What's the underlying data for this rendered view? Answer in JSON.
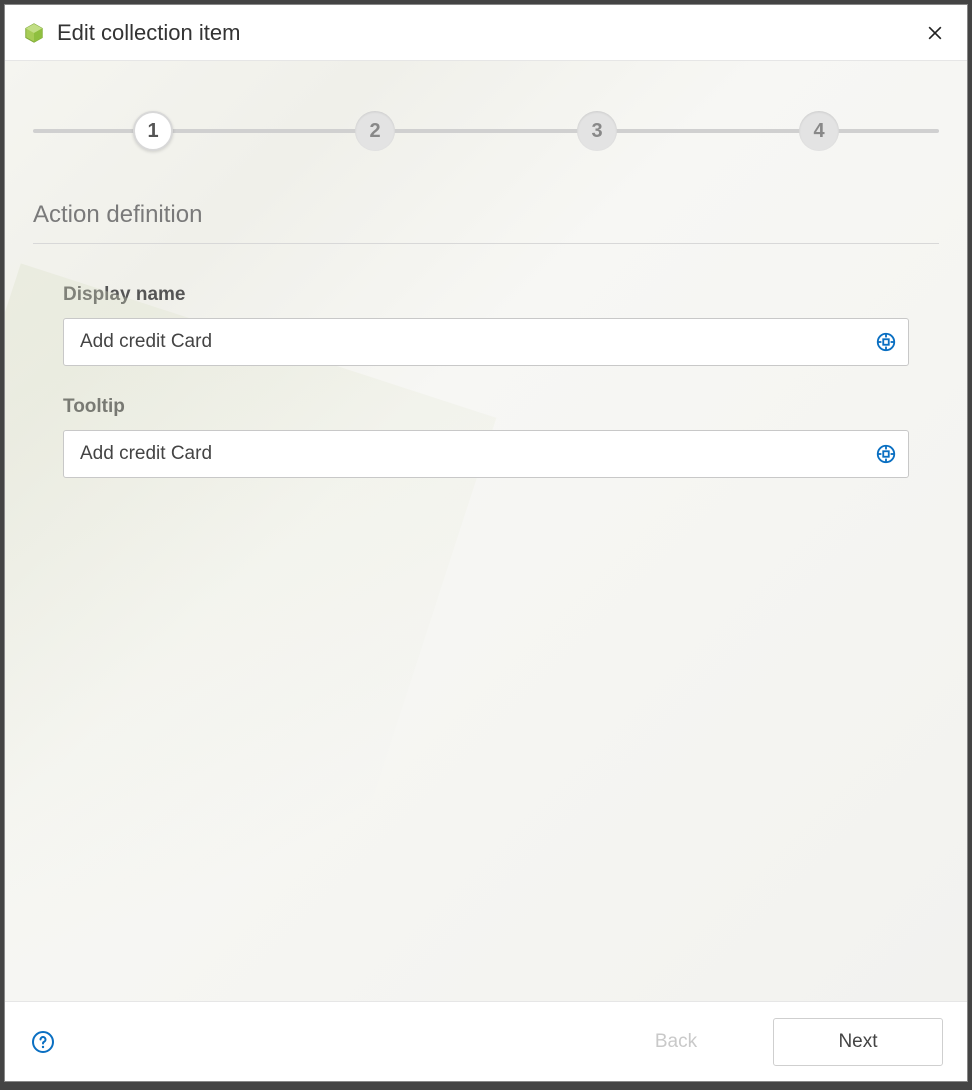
{
  "dialog": {
    "title": "Edit collection item"
  },
  "stepper": {
    "steps": [
      "1",
      "2",
      "3",
      "4"
    ],
    "active_index": 0
  },
  "section": {
    "title": "Action definition"
  },
  "fields": {
    "display_name": {
      "label": "Display name",
      "value": "Add credit Card"
    },
    "tooltip": {
      "label": "Tooltip",
      "value": "Add credit Card"
    }
  },
  "footer": {
    "back_label": "Back",
    "next_label": "Next"
  },
  "colors": {
    "accent_green": "#8fbf3f",
    "icon_blue": "#0a6fc2"
  }
}
